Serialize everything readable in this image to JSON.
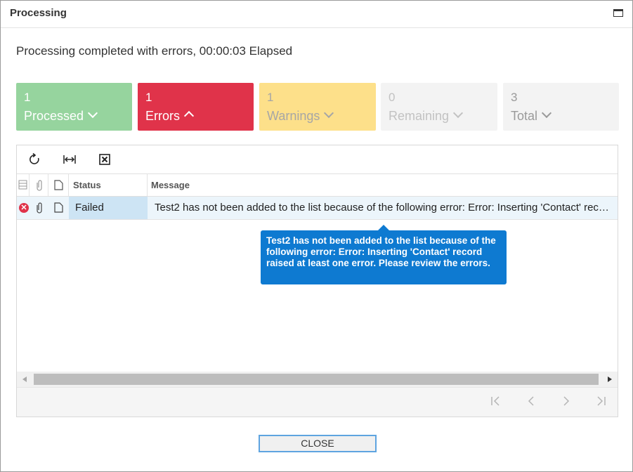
{
  "window": {
    "title": "Processing"
  },
  "summary": "Processing completed with errors, 00:00:03 Elapsed",
  "tiles": [
    {
      "count": "1",
      "label": "Processed",
      "expanded": false,
      "color": "#96d49e"
    },
    {
      "count": "1",
      "label": "Errors",
      "expanded": true,
      "color": "#e0334a"
    },
    {
      "count": "1",
      "label": "Warnings",
      "expanded": false,
      "color": "#fde08a"
    },
    {
      "count": "0",
      "label": "Remaining",
      "expanded": false,
      "color": "#f3f3f3"
    },
    {
      "count": "3",
      "label": "Total",
      "expanded": false,
      "color": "#f3f3f3"
    }
  ],
  "toolbar": {
    "icons": [
      "refresh-icon",
      "fit-columns-icon",
      "export-excel-icon"
    ]
  },
  "grid": {
    "columns": [
      "Status",
      "Message"
    ],
    "rows": [
      {
        "status": "Failed",
        "message": "Test2 has not been added to the list because of the following error: Error: Inserting 'Contact' recor…"
      }
    ]
  },
  "tooltip": "Test2 has not been added to the list because of the following error: Error: Inserting 'Contact' record raised at least one error. Please review the errors.",
  "close_label": "CLOSE"
}
